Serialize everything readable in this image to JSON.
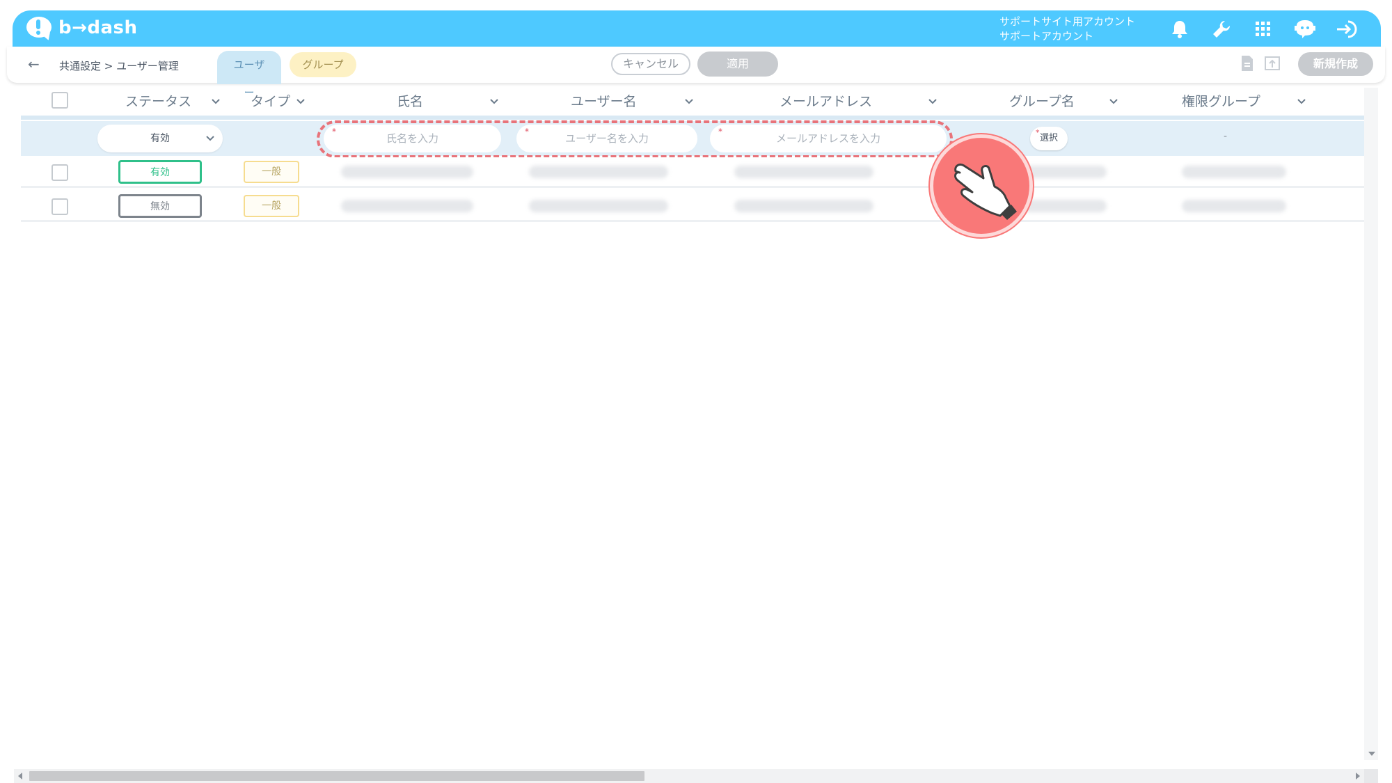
{
  "app": {
    "logo_text": "b→dash",
    "account_line1": "サポートサイト用アカウント",
    "account_line2": "サポートアカウント"
  },
  "top_icons": [
    "bell-icon",
    "wrench-icon",
    "grid-icon",
    "chat-robot-icon",
    "logout-icon"
  ],
  "subbar": {
    "breadcrumb": "共通設定 > ユーザー管理",
    "tabs": [
      {
        "label": "ユーザー",
        "active": true
      },
      {
        "label": "グループ",
        "active": false
      }
    ],
    "cancel_label": "キャンセル",
    "apply_label": "適用",
    "new_label": "新規作成"
  },
  "columns": [
    {
      "label": "ステータス"
    },
    {
      "label": "タイプ"
    },
    {
      "label": "氏名"
    },
    {
      "label": "ユーザー名"
    },
    {
      "label": "メールアドレス"
    },
    {
      "label": "グループ名"
    },
    {
      "label": "権限グループ"
    }
  ],
  "filter": {
    "status_value": "有効",
    "required_mark": "*",
    "name_placeholder": "氏名を入力",
    "username_placeholder": "ユーザー名を入力",
    "email_placeholder": "メールアドレスを入力",
    "group_button": "選択",
    "permission_value": "-"
  },
  "rows": [
    {
      "status": "有効",
      "status_kind": "active",
      "type": "一般"
    },
    {
      "status": "無効",
      "status_kind": "inactive",
      "type": "一般"
    }
  ],
  "colors": {
    "topbar": "#4ec9ff",
    "active_status": "#2fc08a",
    "inactive_status": "#7d848c",
    "highlight_dashed": "#e8737a",
    "hand_hint": "#f97878"
  }
}
